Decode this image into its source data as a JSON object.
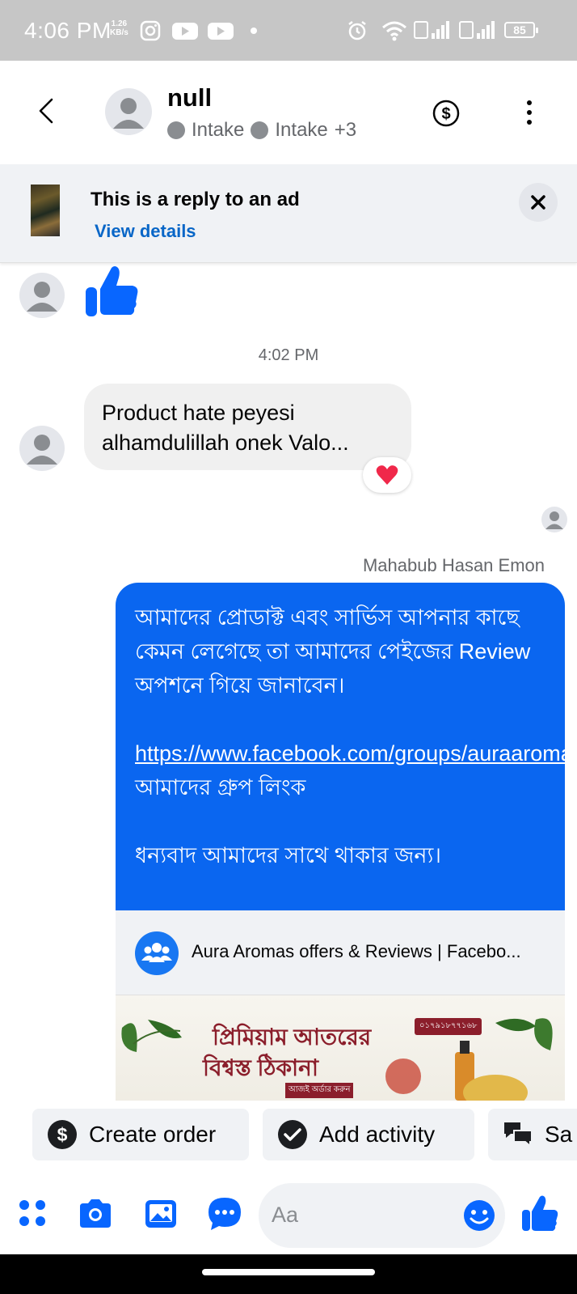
{
  "status_bar": {
    "time": "4:06 PM",
    "net_speed_value": "1.26",
    "net_speed_unit": "KB/s",
    "battery": "85",
    "icons": [
      "instagram-icon",
      "youtube-icon",
      "youtube-icon",
      "alarm-icon",
      "wifi-icon",
      "signal-icon",
      "signal-icon"
    ]
  },
  "header": {
    "contact_name": "null",
    "labels": [
      "Intake",
      "Intake"
    ],
    "more_labels": "+3"
  },
  "ad_banner": {
    "title": "This is a reply to an ad",
    "link": "View details"
  },
  "conversation": {
    "timestamp": "4:02 PM",
    "incoming_message": "Product hate peyesi alhamdulillah onek Valo...",
    "reaction": "❤️",
    "sender_name": "Mahabub Hasan Emon",
    "outgoing": {
      "para1": "আমাদের প্রোডাক্ট এবং সার্ভিস আপনার কাছে কেমন লেগেছে তা আমাদের পেইজের Review অপশনে গিয়ে জানাবেন।",
      "link_url": "https://www.facebook.com/groups/auraaromasbd",
      "link_suffix": " আমাদের গ্রুপ লিংক",
      "para3": "ধন্যবাদ আমাদের সাথে থাকার জন্য।"
    },
    "link_preview": {
      "title": "Aura Aromas offers & Reviews | Facebo...",
      "image_line1": "প্রিমিয়াম আতরের",
      "image_line2": "বিশ্বস্ত ঠিকানা",
      "image_sub": "আজই অর্ডার করুন",
      "image_phone": "০১৭৯১৮৭৭১৬৮"
    }
  },
  "quick_actions": [
    {
      "label": "Create order",
      "icon": "dollar-icon"
    },
    {
      "label": "Add activity",
      "icon": "check-circle-icon"
    },
    {
      "label": "Sa",
      "icon": "chat-bubbles-icon"
    }
  ],
  "composer": {
    "placeholder": "Aa",
    "icons": [
      "menu-dots-icon",
      "camera-icon",
      "image-icon",
      "chat-icon",
      "emoji-icon",
      "thumbs-up-icon"
    ]
  },
  "colors": {
    "accent": "#0866ff",
    "bubble_out": "#0a66f0",
    "bubble_in": "#f0f0f0",
    "status_bar": "#c6c6c6"
  }
}
